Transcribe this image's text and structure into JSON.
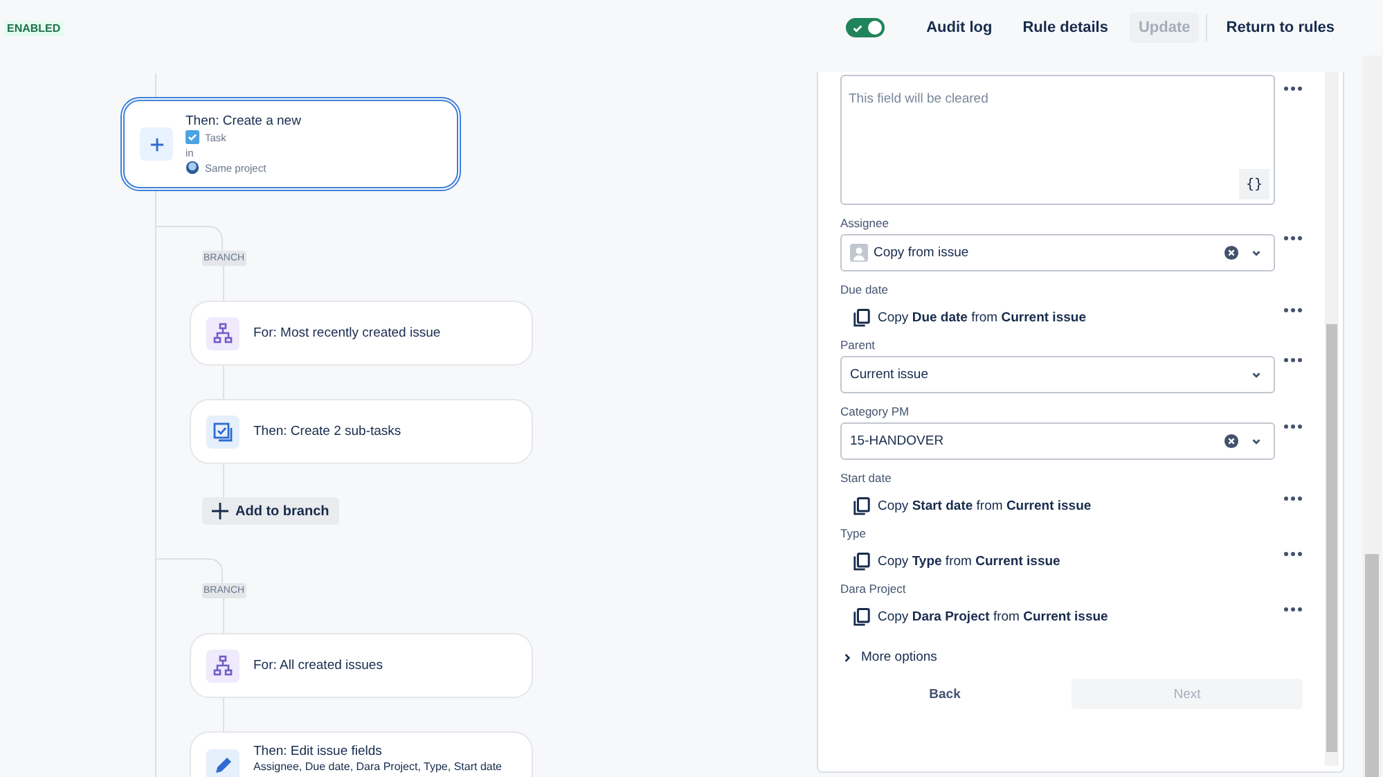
{
  "header": {
    "status": "ENABLED",
    "toggle": {
      "on": true
    },
    "links": [
      {
        "label": "Audit log",
        "disabled": false
      },
      {
        "label": "Rule details",
        "disabled": false
      },
      {
        "label": "Update",
        "disabled": true
      },
      {
        "label": "Return to rules",
        "disabled": false
      }
    ]
  },
  "flow": {
    "main_node": {
      "title": "Then: Create a new",
      "issue_type": "Task",
      "connector": "in",
      "project": "Same project",
      "selected": true
    },
    "branches": [
      {
        "tag": "BRANCH",
        "nodes": [
          {
            "kind": "for",
            "title": "For: Most recently created issue"
          },
          {
            "kind": "subtasks",
            "title": "Then: Create 2 sub-tasks"
          }
        ],
        "add_button": "Add to branch"
      },
      {
        "tag": "BRANCH",
        "nodes": [
          {
            "kind": "for",
            "title": "For: All created issues"
          },
          {
            "kind": "edit",
            "title": "Then: Edit issue fields",
            "subtitle": "Assignee, Due date, Dara Project, Type, Start date"
          }
        ]
      }
    ]
  },
  "panel": {
    "fields": [
      {
        "kind": "textarea",
        "placeholder": "This field will be cleared",
        "button": "{}"
      },
      {
        "kind": "select",
        "label": "Assignee",
        "value": "Copy from issue",
        "avatar": true,
        "clearable": true
      },
      {
        "kind": "copy",
        "label": "Due date",
        "text": "Copy **Due date** from **Current issue**"
      },
      {
        "kind": "select",
        "label": "Parent",
        "value": "Current issue",
        "avatar": false,
        "clearable": false
      },
      {
        "kind": "select",
        "label": "Category PM",
        "value": "15-HANDOVER",
        "avatar": false,
        "clearable": true
      },
      {
        "kind": "copy",
        "label": "Start date",
        "text": "Copy **Start date** from **Current issue**"
      },
      {
        "kind": "copy",
        "label": "Type",
        "text": "Copy **Type** from **Current issue**"
      },
      {
        "kind": "copy",
        "label": "Dara Project",
        "text": "Copy **Dara Project** from **Current issue**"
      }
    ],
    "more_options": {
      "label": "More options",
      "expanded": false
    },
    "back": "Back",
    "next": {
      "label": "Next",
      "disabled": true
    }
  }
}
